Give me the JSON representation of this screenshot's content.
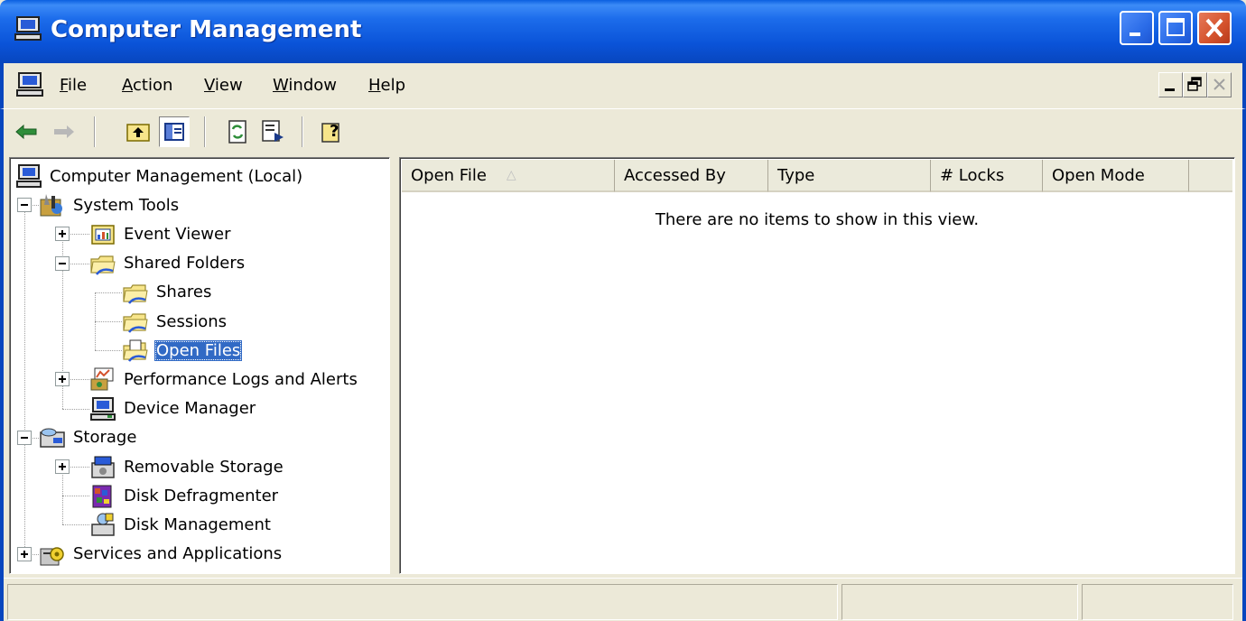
{
  "window": {
    "title": "Computer Management",
    "caption_buttons": [
      "minimize",
      "maximize",
      "close"
    ]
  },
  "menu": {
    "items": [
      {
        "label": "File",
        "mnemonic": "F"
      },
      {
        "label": "Action",
        "mnemonic": "A"
      },
      {
        "label": "View",
        "mnemonic": "V"
      },
      {
        "label": "Window",
        "mnemonic": "W"
      },
      {
        "label": "Help",
        "mnemonic": "H"
      }
    ]
  },
  "toolbar": {
    "buttons": [
      "back-arrow-icon",
      "forward-arrow-icon",
      "up-folder-icon",
      "show-hide-tree-icon",
      "refresh-icon",
      "export-list-icon",
      "help-icon"
    ],
    "pressed": "show-hide-tree-icon"
  },
  "tree": {
    "nodes": [
      {
        "label": "Computer Management (Local)",
        "level": 0,
        "icon": "computer-icon"
      },
      {
        "label": "System Tools",
        "level": 1,
        "icon": "tools-icon",
        "expanded": true
      },
      {
        "label": "Event Viewer",
        "level": 2,
        "icon": "event-viewer-icon",
        "expanded": false
      },
      {
        "label": "Shared Folders",
        "level": 2,
        "icon": "shared-folder-icon",
        "expanded": true
      },
      {
        "label": "Shares",
        "level": 3,
        "icon": "shared-folder-icon"
      },
      {
        "label": "Sessions",
        "level": 3,
        "icon": "shared-folder-icon"
      },
      {
        "label": "Open Files",
        "level": 3,
        "icon": "open-files-icon",
        "selected": true
      },
      {
        "label": "Performance Logs and Alerts",
        "level": 2,
        "icon": "performance-icon",
        "expanded": false
      },
      {
        "label": "Device Manager",
        "level": 2,
        "icon": "device-manager-icon"
      },
      {
        "label": "Storage",
        "level": 1,
        "icon": "storage-icon",
        "expanded": true
      },
      {
        "label": "Removable Storage",
        "level": 2,
        "icon": "removable-storage-icon",
        "expanded": false
      },
      {
        "label": "Disk Defragmenter",
        "level": 2,
        "icon": "defrag-icon"
      },
      {
        "label": "Disk Management",
        "level": 2,
        "icon": "disk-management-icon"
      },
      {
        "label": "Services and Applications",
        "level": 1,
        "icon": "services-icon",
        "expanded": false
      }
    ]
  },
  "list": {
    "columns": [
      "Open File",
      "Accessed By",
      "Type",
      "# Locks",
      "Open Mode"
    ],
    "sorted_column": "Open File",
    "sort_direction": "ascending",
    "rows": [],
    "empty_message": "There are no items to show in this view."
  },
  "colors": {
    "titlebar": "#0A53D8",
    "selection": "#316AC5",
    "face": "#ECE9D8",
    "close_button": "#D4522C"
  }
}
